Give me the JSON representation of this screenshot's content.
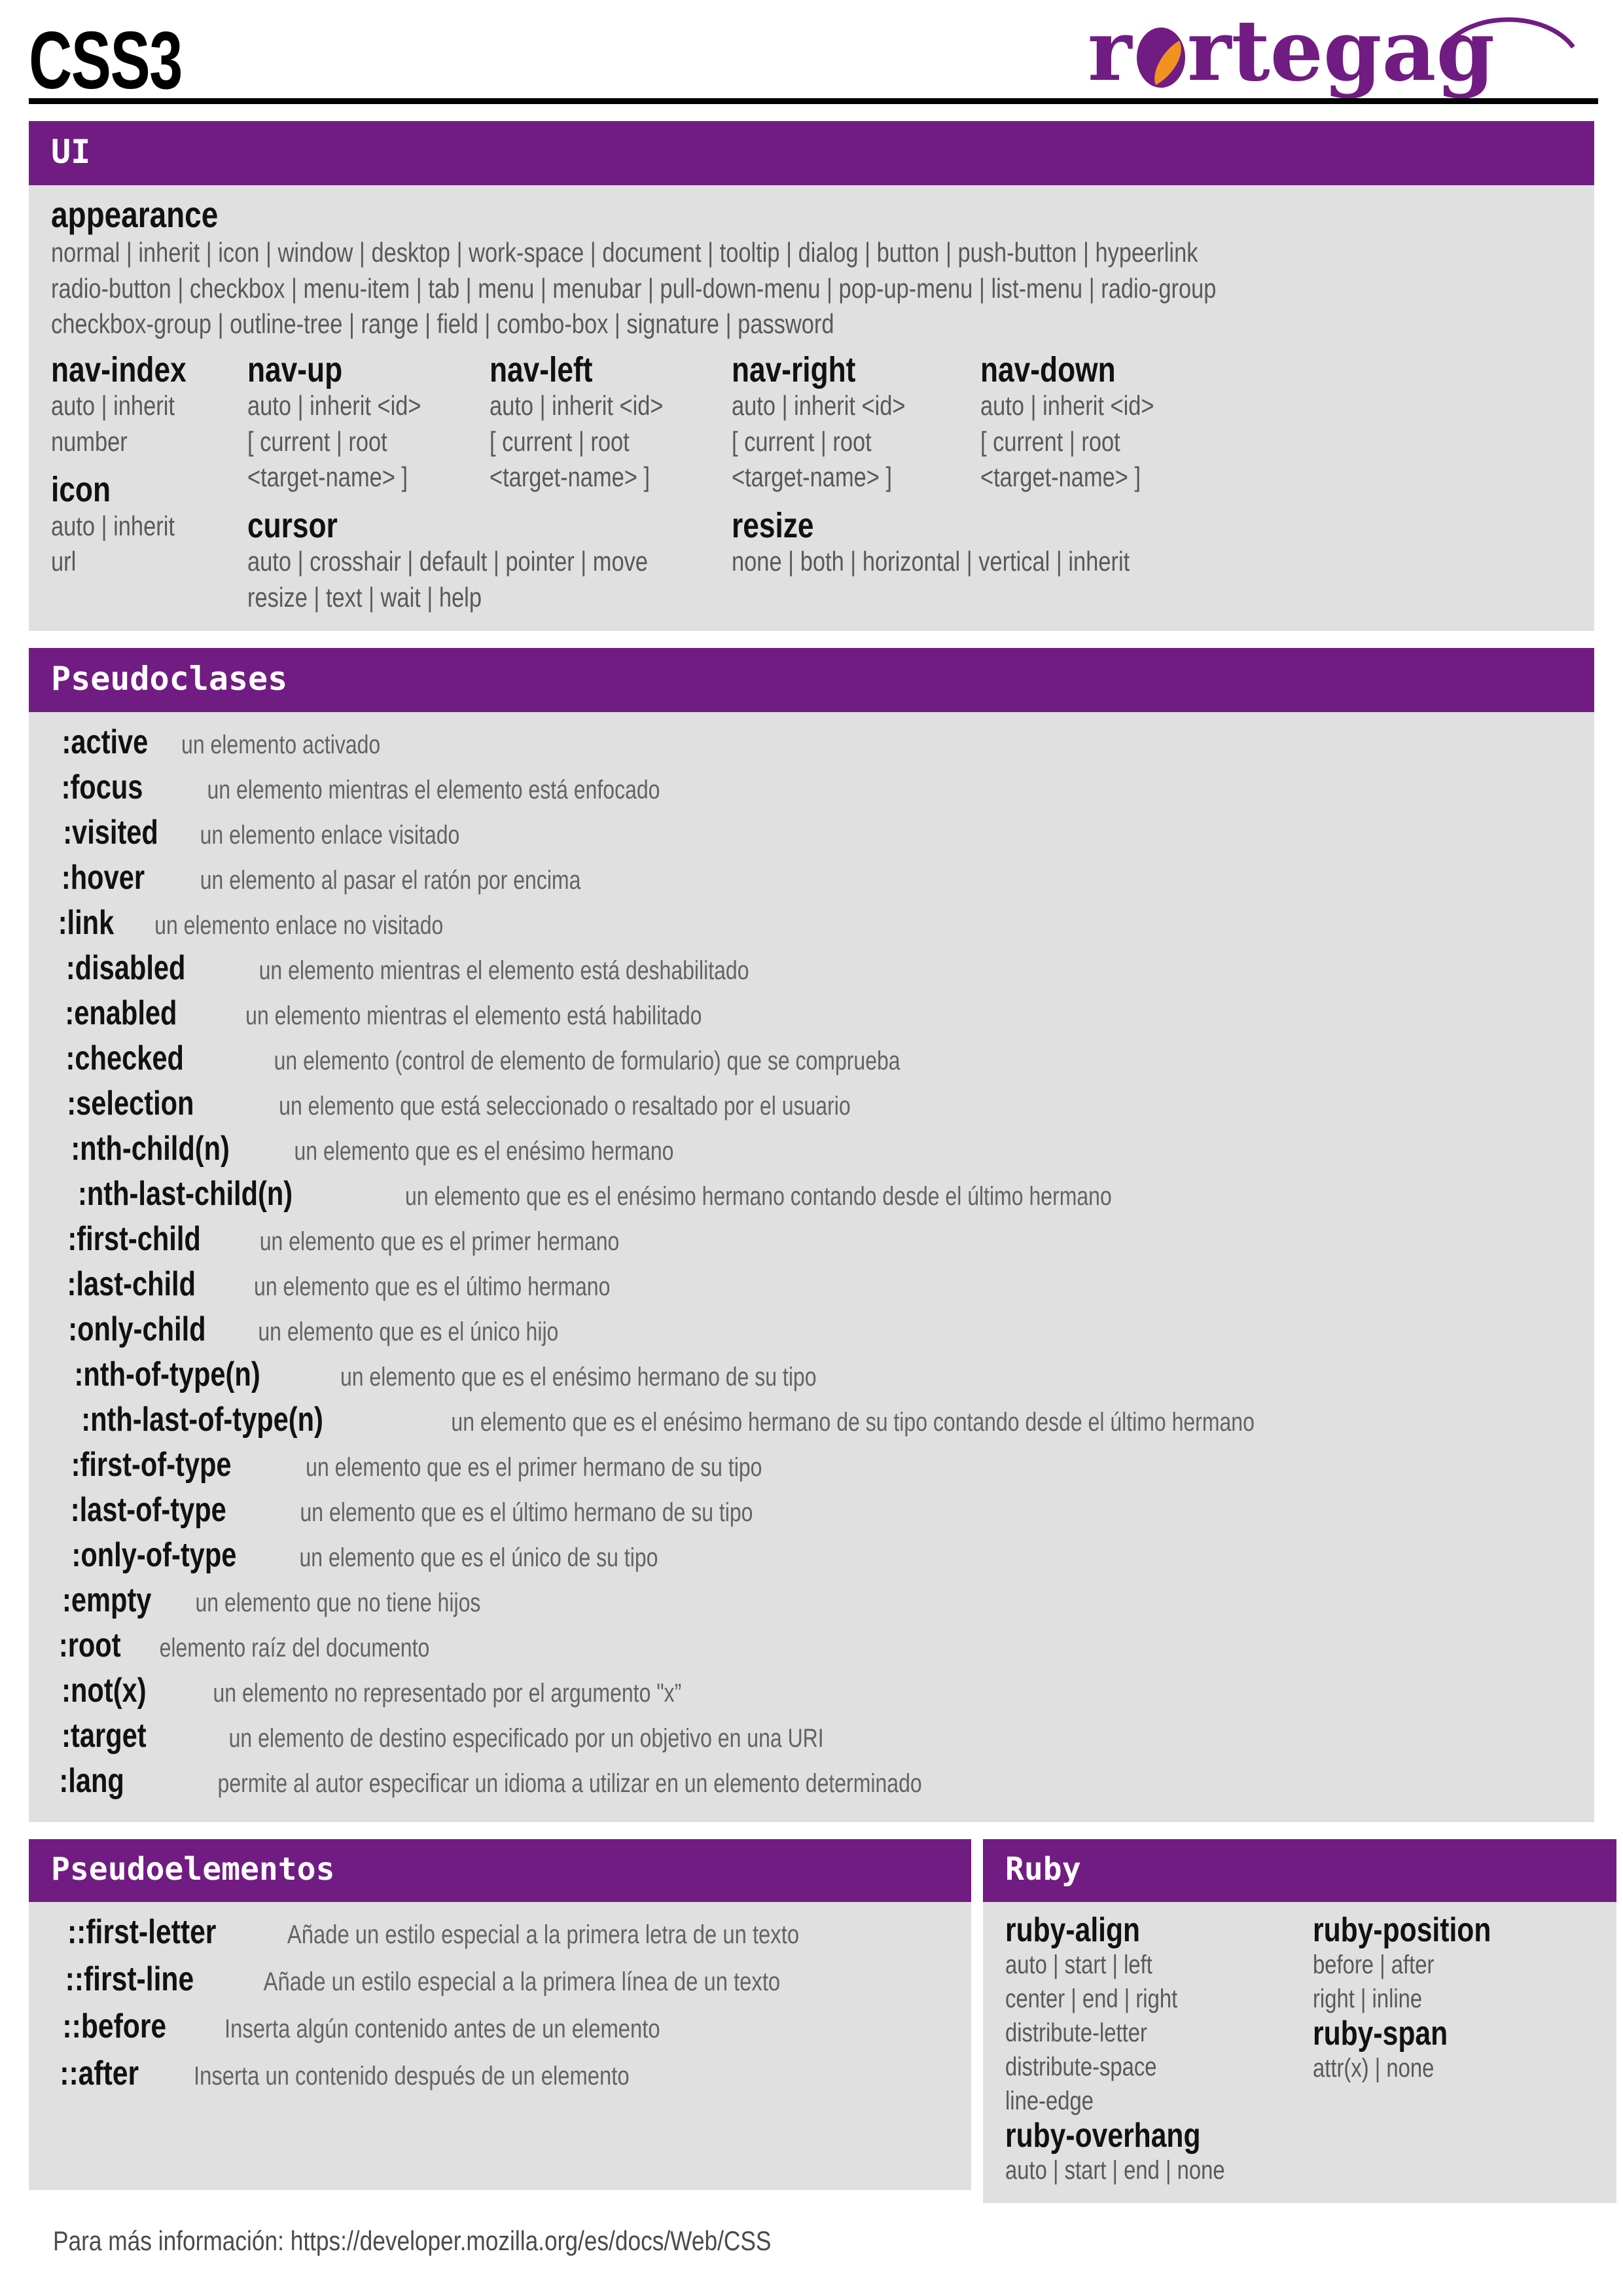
{
  "header": {
    "title": "CSS3",
    "logo_text": "rortegag",
    "logo_color": "#711C82",
    "logo_accent_color": "#F29221"
  },
  "theme": {
    "header_bg": "#711C82",
    "panel_bg": "#E0E0E0",
    "prop_color": "#111111",
    "value_color": "#636363",
    "page_bg": "#FFFFFF"
  },
  "sections": {
    "ui": {
      "title": "UI",
      "appearance": {
        "property": "appearance",
        "values": [
          "normal | inherit | icon | window | desktop | work-space | document | tooltip | dialog | button | push-button | hypeerlink",
          "radio-button | checkbox | menu-item | tab | menu | menubar | pull-down-menu | pop-up-menu | list-menu | radio-group",
          "checkbox-group | outline-tree | range | field | combo-box | signature | password"
        ]
      },
      "columns": [
        {
          "properties": [
            {
              "name": "nav-index",
              "values": [
                "auto | inherit",
                "number"
              ]
            },
            {
              "name": "icon",
              "values": [
                "auto | inherit",
                "url"
              ]
            }
          ]
        },
        {
          "properties": [
            {
              "name": "nav-up",
              "values": [
                "auto | inherit <id>",
                "[ current | root",
                "<target-name> ]"
              ]
            },
            {
              "name": "cursor",
              "values": [
                "auto | crosshair | default | pointer | move",
                "resize | text | wait | help"
              ]
            }
          ]
        },
        {
          "properties": [
            {
              "name": "nav-left",
              "values": [
                "auto | inherit <id>",
                "[ current | root",
                "<target-name> ]"
              ]
            }
          ]
        },
        {
          "properties": [
            {
              "name": "nav-right",
              "values": [
                "auto | inherit <id>",
                "[ current | root",
                "<target-name> ]"
              ]
            },
            {
              "name": "resize",
              "values": [
                "none | both | horizontal | vertical | inherit"
              ]
            }
          ]
        },
        {
          "properties": [
            {
              "name": "nav-down",
              "values": [
                "auto | inherit <id>",
                "[ current | root",
                "<target-name> ]"
              ]
            }
          ]
        }
      ]
    },
    "pseudoclases": {
      "title": "Pseudoclases",
      "items": [
        {
          "name": ":active",
          "desc": "un elemento activado"
        },
        {
          "name": ":focus",
          "desc": "un elemento mientras el elemento está enfocado"
        },
        {
          "name": ":visited",
          "desc": "un elemento enlace visitado"
        },
        {
          "name": ":hover",
          "desc": "un elemento al pasar el ratón por encima"
        },
        {
          "name": ":link",
          "desc": "un elemento enlace no visitado"
        },
        {
          "name": ":disabled",
          "desc": "un elemento mientras el elemento está deshabilitado"
        },
        {
          "name": ":enabled",
          "desc": "un elemento mientras el elemento está habilitado"
        },
        {
          "name": ":checked",
          "desc": "un elemento (control de elemento de formulario) que se comprueba"
        },
        {
          "name": ":selection",
          "desc": "un elemento que está seleccionado o resaltado por el usuario"
        },
        {
          "name": ":nth-child(n)",
          "desc": "un elemento que es el enésimo hermano"
        },
        {
          "name": ":nth-last-child(n)",
          "desc": "un elemento que es el enésimo hermano contando desde el último hermano"
        },
        {
          "name": ":first-child",
          "desc": "un elemento que es el primer hermano"
        },
        {
          "name": ":last-child",
          "desc": "un elemento que es el último hermano"
        },
        {
          "name": ":only-child",
          "desc": "un elemento que es el único hijo"
        },
        {
          "name": ":nth-of-type(n)",
          "desc": "un elemento que es el enésimo hermano de su tipo"
        },
        {
          "name": ":nth-last-of-type(n)",
          "desc": "un elemento que es el enésimo hermano de su tipo contando desde el último hermano"
        },
        {
          "name": ":first-of-type",
          "desc": "un elemento que es el primer hermano de su tipo"
        },
        {
          "name": ":last-of-type",
          "desc": "un elemento que es el último hermano de su tipo"
        },
        {
          "name": ":only-of-type",
          "desc": "un elemento que es el único de su tipo"
        },
        {
          "name": ":empty",
          "desc": "un elemento que no tiene hijos"
        },
        {
          "name": ":root",
          "desc": "elemento raíz del documento"
        },
        {
          "name": ":not(x)",
          "desc": "un elemento no representado por el argumento \"x”"
        },
        {
          "name": ":target",
          "desc": "un elemento de destino especificado por un objetivo en una URI"
        },
        {
          "name": ":lang",
          "desc": "permite al autor especificar un idioma a utilizar en un elemento determinado"
        }
      ]
    },
    "pseudoelementos": {
      "title": "Pseudoelementos",
      "items": [
        {
          "name": "::first-letter",
          "desc": "Añade un estilo especial a la primera letra de un texto"
        },
        {
          "name": "::first-line",
          "desc": "Añade un estilo especial a la primera línea de un texto"
        },
        {
          "name": "::before",
          "desc": "Inserta algún contenido antes de un elemento"
        },
        {
          "name": "::after",
          "desc": "Inserta un contenido después de un elemento"
        }
      ]
    },
    "ruby": {
      "title": "Ruby",
      "columns": [
        {
          "properties": [
            {
              "name": "ruby-align",
              "values": [
                "auto | start | left",
                "center | end | right",
                "distribute-letter",
                "distribute-space",
                "line-edge"
              ]
            },
            {
              "name": "ruby-overhang",
              "values": [
                "auto | start | end | none"
              ]
            }
          ]
        },
        {
          "properties": [
            {
              "name": "ruby-position",
              "values": [
                "before | after",
                "right | inline"
              ]
            },
            {
              "name": "ruby-span",
              "values": [
                "attr(x) | none"
              ]
            }
          ]
        }
      ]
    }
  },
  "footer": {
    "text": "Para más información: https://developer.mozilla.org/es/docs/Web/CSS"
  }
}
